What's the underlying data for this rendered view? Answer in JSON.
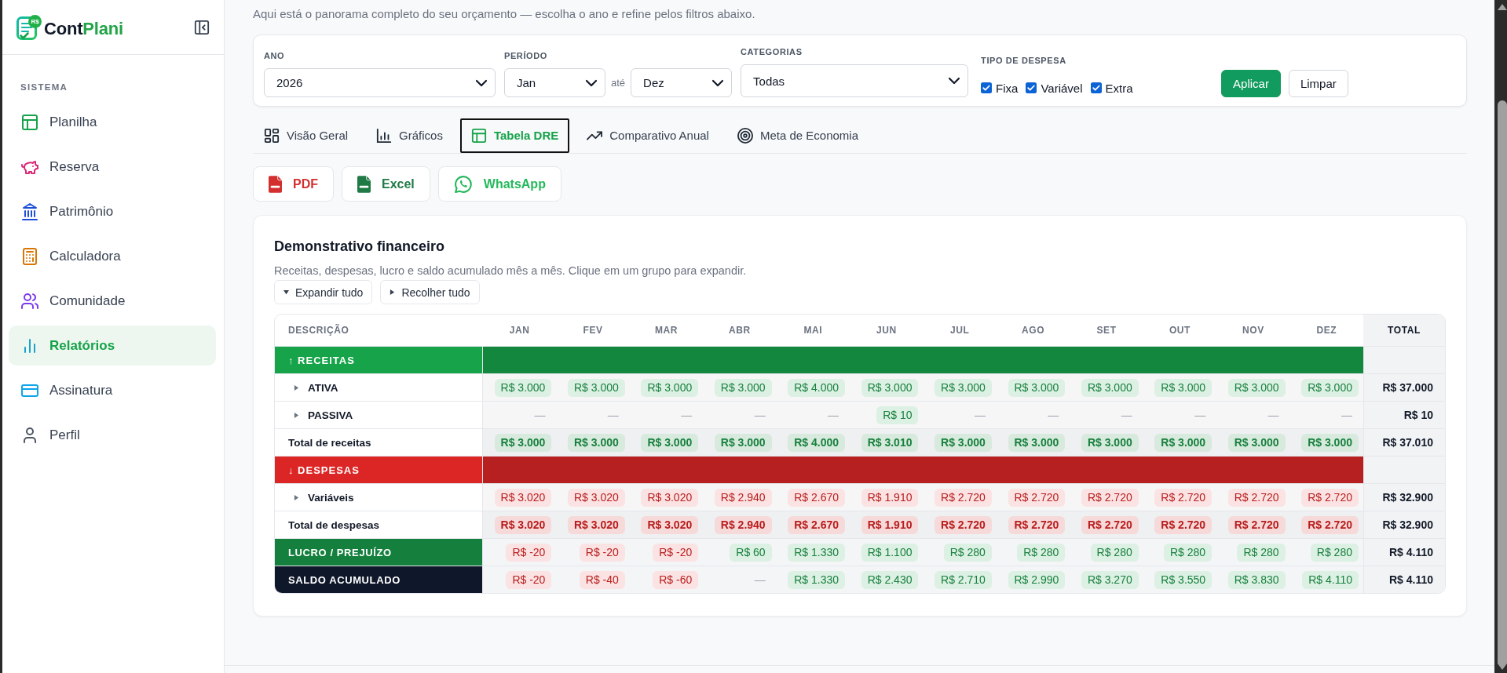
{
  "sidebar": {
    "logo": {
      "badge": "R$",
      "name": "Cont",
      "name_accent": "Plani"
    },
    "section": "SISTEMA",
    "items": [
      {
        "label": "Planilha",
        "selected": false
      },
      {
        "label": "Reserva",
        "selected": false
      },
      {
        "label": "Patrimônio",
        "selected": false
      },
      {
        "label": "Calculadora",
        "selected": false
      },
      {
        "label": "Comunidade",
        "selected": false
      },
      {
        "label": "Relatórios",
        "selected": true
      },
      {
        "label": "Assinatura",
        "selected": false
      },
      {
        "label": "Perfil",
        "selected": false
      }
    ]
  },
  "intro": "Aqui está o panorama completo do seu orçamento — escolha o ano e refine pelos filtros abaixo.",
  "filters": {
    "year": {
      "label": "ANO",
      "value": "2026"
    },
    "period": {
      "label": "PERÍODO",
      "from": "Jan",
      "separator": "até",
      "to": "Dez"
    },
    "categories": {
      "label": "CATEGORIAS",
      "value": "Todas"
    },
    "expense_type": {
      "label": "TIPO DE DESPESA",
      "options": [
        {
          "label": "Fixa",
          "checked": true
        },
        {
          "label": "Variável",
          "checked": true
        },
        {
          "label": "Extra",
          "checked": true
        }
      ]
    },
    "buttons": [
      {
        "label": "Aplicar",
        "kind": "primary"
      },
      {
        "label": "Limpar",
        "kind": "secondary"
      }
    ]
  },
  "tabs": [
    {
      "label": "Visão Geral",
      "selected": false
    },
    {
      "label": "Gráficos",
      "selected": false
    },
    {
      "label": "Tabela DRE",
      "selected": true
    },
    {
      "label": "Comparativo Anual",
      "selected": false
    },
    {
      "label": "Meta de Economia",
      "selected": false
    }
  ],
  "exports": [
    {
      "label": "PDF",
      "color": "#d32f2f"
    },
    {
      "label": "Excel",
      "color": "#1f7a45"
    },
    {
      "label": "WhatsApp",
      "color": "#25b85c"
    }
  ],
  "report": {
    "title": "Demonstrativo financeiro",
    "description": "Receitas, despesas, lucro e saldo acumulado mês a mês. Clique em um grupo para expandir.",
    "actions": [
      "Expandir tudo",
      "Recolher tudo"
    ],
    "table": {
      "columns": [
        "DESCRIÇÃO",
        "JAN",
        "FEV",
        "MAR",
        "ABR",
        "MAI",
        "JUN",
        "JUL",
        "AGO",
        "SET",
        "OUT",
        "NOV",
        "DEZ",
        "TOTAL"
      ],
      "rows": [
        {
          "kind": "group",
          "label": "↑ RECEITAS",
          "color": "#16a34a"
        },
        {
          "kind": "item",
          "label": "ATIVA",
          "expanded": false,
          "cells": [
            {
              "value": "R$ 3.000",
              "kind": "positive"
            },
            {
              "value": "R$ 3.000",
              "kind": "positive"
            },
            {
              "value": "R$ 3.000",
              "kind": "positive"
            },
            {
              "value": "R$ 3.000",
              "kind": "positive"
            },
            {
              "value": "R$ 4.000",
              "kind": "positive"
            },
            {
              "value": "R$ 3.000",
              "kind": "positive"
            },
            {
              "value": "R$ 3.000",
              "kind": "positive"
            },
            {
              "value": "R$ 3.000",
              "kind": "positive"
            },
            {
              "value": "R$ 3.000",
              "kind": "positive"
            },
            {
              "value": "R$ 3.000",
              "kind": "positive"
            },
            {
              "value": "R$ 3.000",
              "kind": "positive"
            },
            {
              "value": "R$ 3.000",
              "kind": "positive"
            }
          ],
          "total": "R$ 37.000"
        },
        {
          "kind": "item",
          "label": "PASSIVA",
          "expanded": false,
          "cells": [
            {
              "value": "—",
              "kind": "empty"
            },
            {
              "value": "—",
              "kind": "empty"
            },
            {
              "value": "—",
              "kind": "empty"
            },
            {
              "value": "—",
              "kind": "empty"
            },
            {
              "value": "—",
              "kind": "empty"
            },
            {
              "value": "R$ 10",
              "kind": "positive"
            },
            {
              "value": "—",
              "kind": "empty"
            },
            {
              "value": "—",
              "kind": "empty"
            },
            {
              "value": "—",
              "kind": "empty"
            },
            {
              "value": "—",
              "kind": "empty"
            },
            {
              "value": "—",
              "kind": "empty"
            },
            {
              "value": "—",
              "kind": "empty"
            }
          ],
          "total": "R$ 10"
        },
        {
          "kind": "total",
          "label": "Total de receitas",
          "cells": [
            {
              "value": "R$ 3.000",
              "kind": "positive"
            },
            {
              "value": "R$ 3.000",
              "kind": "positive"
            },
            {
              "value": "R$ 3.000",
              "kind": "positive"
            },
            {
              "value": "R$ 3.000",
              "kind": "positive"
            },
            {
              "value": "R$ 4.000",
              "kind": "positive"
            },
            {
              "value": "R$ 3.010",
              "kind": "positive"
            },
            {
              "value": "R$ 3.000",
              "kind": "positive"
            },
            {
              "value": "R$ 3.000",
              "kind": "positive"
            },
            {
              "value": "R$ 3.000",
              "kind": "positive"
            },
            {
              "value": "R$ 3.000",
              "kind": "positive"
            },
            {
              "value": "R$ 3.000",
              "kind": "positive"
            },
            {
              "value": "R$ 3.000",
              "kind": "positive"
            }
          ],
          "total": "R$ 37.010"
        },
        {
          "kind": "group",
          "label": "↓ DESPESAS",
          "color": "#dc2626"
        },
        {
          "kind": "item",
          "label": "Variáveis",
          "expanded": false,
          "cells": [
            {
              "value": "R$ 3.020",
              "kind": "negative"
            },
            {
              "value": "R$ 3.020",
              "kind": "negative"
            },
            {
              "value": "R$ 3.020",
              "kind": "negative"
            },
            {
              "value": "R$ 2.940",
              "kind": "negative"
            },
            {
              "value": "R$ 2.670",
              "kind": "negative"
            },
            {
              "value": "R$ 1.910",
              "kind": "negative"
            },
            {
              "value": "R$ 2.720",
              "kind": "negative"
            },
            {
              "value": "R$ 2.720",
              "kind": "negative"
            },
            {
              "value": "R$ 2.720",
              "kind": "negative"
            },
            {
              "value": "R$ 2.720",
              "kind": "negative"
            },
            {
              "value": "R$ 2.720",
              "kind": "negative"
            },
            {
              "value": "R$ 2.720",
              "kind": "negative"
            }
          ],
          "total": "R$ 32.900"
        },
        {
          "kind": "total",
          "label": "Total de despesas",
          "cells": [
            {
              "value": "R$ 3.020",
              "kind": "negative"
            },
            {
              "value": "R$ 3.020",
              "kind": "negative"
            },
            {
              "value": "R$ 3.020",
              "kind": "negative"
            },
            {
              "value": "R$ 2.940",
              "kind": "negative"
            },
            {
              "value": "R$ 2.670",
              "kind": "negative"
            },
            {
              "value": "R$ 1.910",
              "kind": "negative"
            },
            {
              "value": "R$ 2.720",
              "kind": "negative"
            },
            {
              "value": "R$ 2.720",
              "kind": "negative"
            },
            {
              "value": "R$ 2.720",
              "kind": "negative"
            },
            {
              "value": "R$ 2.720",
              "kind": "negative"
            },
            {
              "value": "R$ 2.720",
              "kind": "negative"
            },
            {
              "value": "R$ 2.720",
              "kind": "negative"
            }
          ],
          "total": "R$ 32.900"
        },
        {
          "kind": "result",
          "label": "LUCRO / PREJUÍZO",
          "color": "#15803d",
          "cells": [
            {
              "value": "R$ -20",
              "kind": "negative"
            },
            {
              "value": "R$ -20",
              "kind": "negative"
            },
            {
              "value": "R$ -20",
              "kind": "negative"
            },
            {
              "value": "R$ 60",
              "kind": "positive"
            },
            {
              "value": "R$ 1.330",
              "kind": "positive"
            },
            {
              "value": "R$ 1.100",
              "kind": "positive"
            },
            {
              "value": "R$ 280",
              "kind": "positive"
            },
            {
              "value": "R$ 280",
              "kind": "positive"
            },
            {
              "value": "R$ 280",
              "kind": "positive"
            },
            {
              "value": "R$ 280",
              "kind": "positive"
            },
            {
              "value": "R$ 280",
              "kind": "positive"
            },
            {
              "value": "R$ 280",
              "kind": "positive"
            }
          ],
          "total": "R$ 4.110"
        },
        {
          "kind": "result",
          "label": "SALDO ACUMULADO",
          "color": "#0f172a",
          "cells": [
            {
              "value": "R$ -20",
              "kind": "negative"
            },
            {
              "value": "R$ -40",
              "kind": "negative"
            },
            {
              "value": "R$ -60",
              "kind": "negative"
            },
            {
              "value": "—",
              "kind": "empty"
            },
            {
              "value": "R$ 1.330",
              "kind": "positive"
            },
            {
              "value": "R$ 2.430",
              "kind": "positive"
            },
            {
              "value": "R$ 2.710",
              "kind": "positive"
            },
            {
              "value": "R$ 2.990",
              "kind": "positive"
            },
            {
              "value": "R$ 3.270",
              "kind": "positive"
            },
            {
              "value": "R$ 3.550",
              "kind": "positive"
            },
            {
              "value": "R$ 3.830",
              "kind": "positive"
            },
            {
              "value": "R$ 4.110",
              "kind": "positive"
            }
          ],
          "total": "R$ 4.110"
        }
      ]
    }
  }
}
